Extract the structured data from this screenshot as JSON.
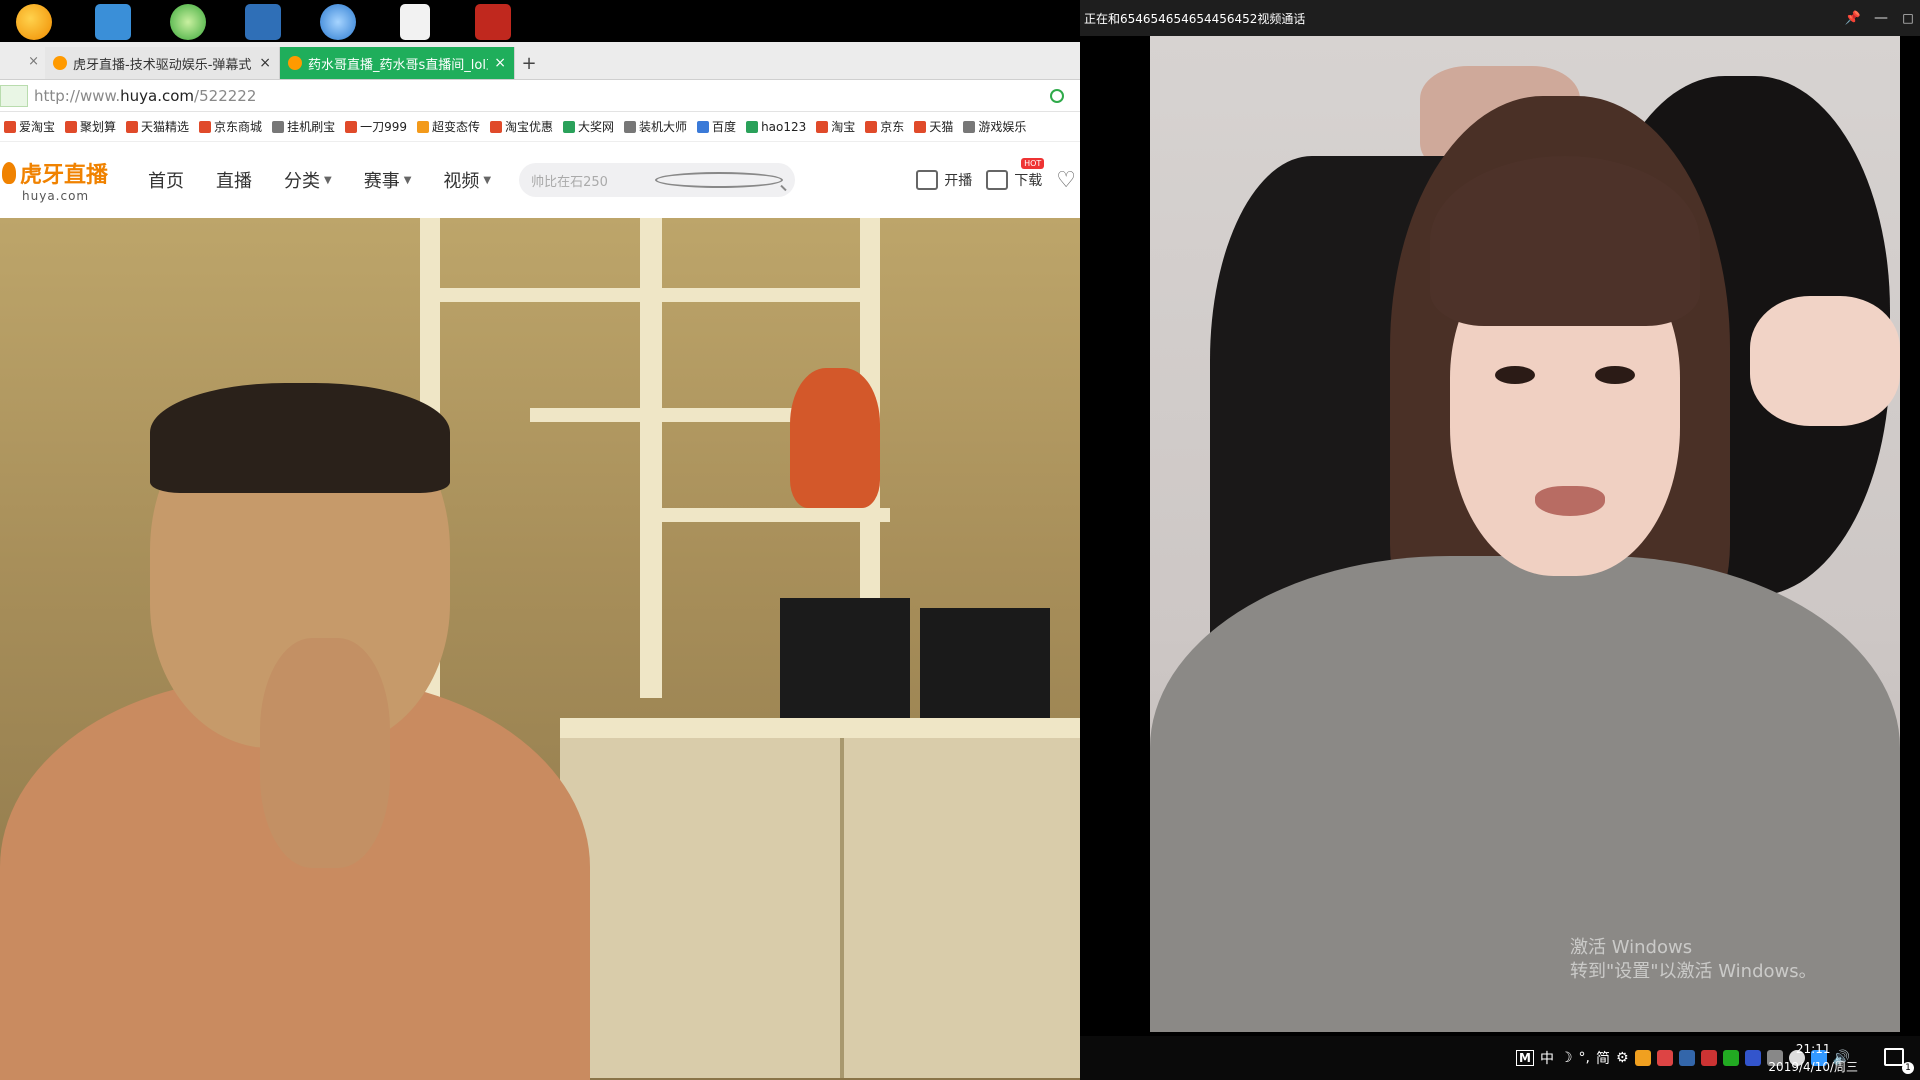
{
  "browser": {
    "tabs": [
      {
        "label": "虎牙直播-技术驱动娱乐-弹幕式"
      },
      {
        "label": "药水哥直播_药水哥s直播间_lol直"
      }
    ],
    "tab_close": "×",
    "new_tab": "+",
    "address": {
      "prefix": "http://www.",
      "domain": "huya.com",
      "path": "/522222"
    },
    "bookmarks": [
      "爱淘宝",
      "聚划算",
      "天猫精选",
      "京东商城",
      "挂机刷宝",
      "一刀999",
      "超变态传",
      "淘宝优惠",
      "大奖网",
      "装机大师",
      "百度",
      "hao123",
      "淘宝",
      "京东",
      "天猫",
      "游戏娱乐"
    ]
  },
  "site": {
    "logo_text": "虎牙直播",
    "logo_sub": "huya.com",
    "nav": [
      "首页",
      "直播",
      "分类",
      "赛事",
      "视频"
    ],
    "search_placeholder": "帅比在石250",
    "start_broadcast": "开播",
    "download": "下载",
    "hot_badge": "HOT"
  },
  "call_window": {
    "title": "正在和654654654654456452视频通话",
    "pin": "📌",
    "minimize": "—",
    "maximize": "□"
  },
  "watermark": {
    "line1": "激活 Windows",
    "line2": "转到\"设置\"以激活 Windows。"
  },
  "taskbar": {
    "ime": "M",
    "ime_lang": "中",
    "ime_moon": "☽",
    "ime_punct": "°,",
    "ime_simplified": "简",
    "ime_settings": "⚙",
    "time": "21:11",
    "date": "2019/4/10/周三",
    "notifications": "1"
  }
}
